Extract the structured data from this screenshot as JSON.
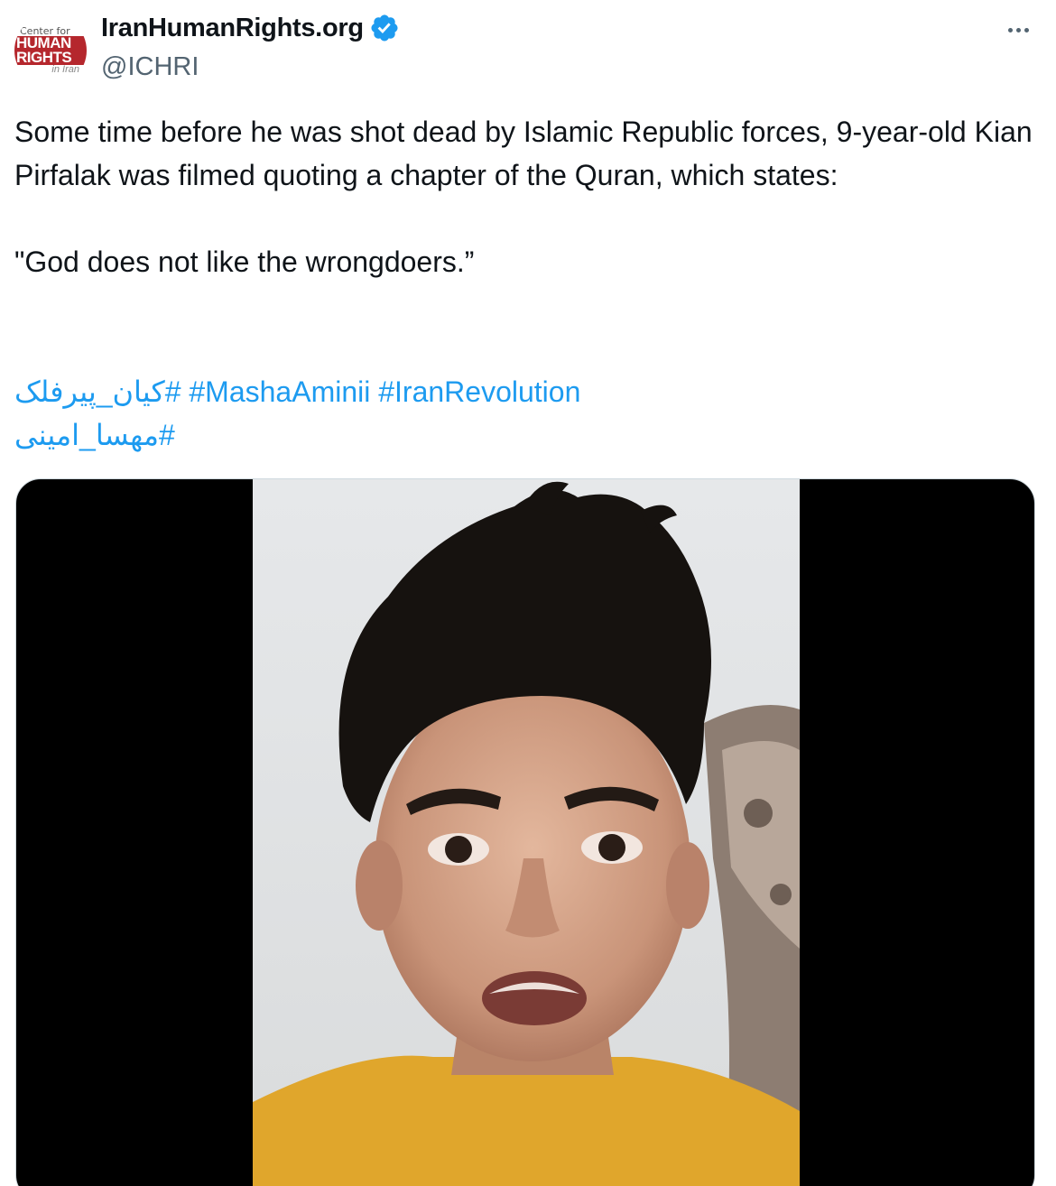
{
  "account": {
    "display_name": "IranHumanRights.org",
    "handle": "@ICHRI",
    "verified": true,
    "avatar_logo": [
      "Center for",
      "HUMAN RIGHTS",
      "in Iran"
    ]
  },
  "tweet": {
    "text": "Some time before he was shot dead by Islamic Republic forces, 9-year-old Kian Pirfalak was filmed quoting a chapter of the Quran, which states:\n\n\"God does not like the wrongdoers.”",
    "hashtags_line1": [
      "#کیان_پیرفلک",
      "#MashaAminii",
      "#IranRevolution"
    ],
    "hashtags_line2": [
      "#مهسا_امینی"
    ]
  },
  "media": {
    "type": "video",
    "description_icon": "video-frame"
  },
  "colors": {
    "link": "#1d9bf0",
    "text": "#0f1419",
    "secondary": "#536471",
    "verified": "#1d9bf0",
    "brand_red": "#b5272d"
  },
  "icons": [
    "verified-badge-icon",
    "more-options-icon"
  ]
}
